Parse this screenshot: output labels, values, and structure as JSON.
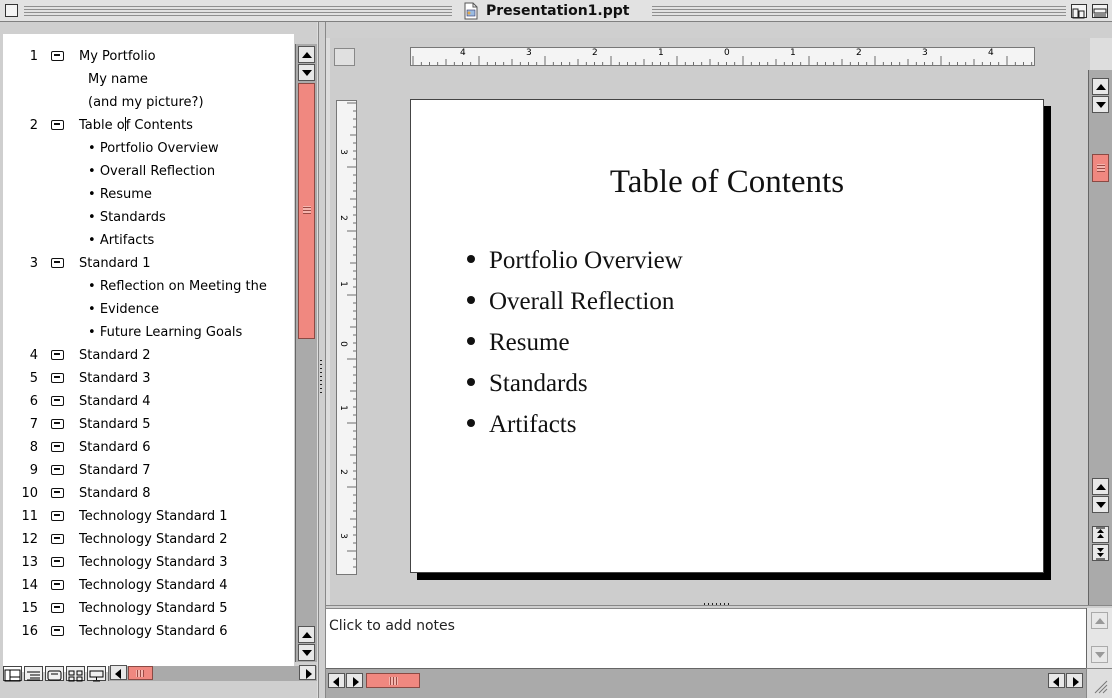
{
  "window": {
    "title": "Presentation1.ppt"
  },
  "outline": {
    "rows": [
      {
        "num": "1",
        "title": "My Portfolio"
      },
      {
        "sub": "My name"
      },
      {
        "sub": "(and my picture?)"
      },
      {
        "num": "2",
        "title_part1": "Table o",
        "title_part2": "f Contents"
      },
      {
        "bullet": "Portfolio Overview"
      },
      {
        "bullet": "Overall Reflection"
      },
      {
        "bullet": "Resume"
      },
      {
        "bullet": "Standards"
      },
      {
        "bullet": "Artifacts"
      },
      {
        "num": "3",
        "title": "Standard 1"
      },
      {
        "bullet": "Reflection on Meeting the"
      },
      {
        "bullet": "Evidence"
      },
      {
        "bullet": "Future Learning Goals"
      },
      {
        "num": "4",
        "title": "Standard 2"
      },
      {
        "num": "5",
        "title": "Standard 3"
      },
      {
        "num": "6",
        "title": "Standard 4"
      },
      {
        "num": "7",
        "title": "Standard 5"
      },
      {
        "num": "8",
        "title": "Standard 6"
      },
      {
        "num": "9",
        "title": "Standard 7"
      },
      {
        "num": "10",
        "title": "Standard 8"
      },
      {
        "num": "11",
        "title": "Technology Standard 1"
      },
      {
        "num": "12",
        "title": "Technology Standard 2"
      },
      {
        "num": "13",
        "title": "Technology Standard 3"
      },
      {
        "num": "14",
        "title": "Technology Standard 4"
      },
      {
        "num": "15",
        "title": "Technology Standard 5"
      },
      {
        "num": "16",
        "title": "Technology Standard 6"
      }
    ]
  },
  "ruler": {
    "horizontal": [
      "4",
      "3",
      "2",
      "1",
      "0",
      "1",
      "2",
      "3",
      "4"
    ],
    "vertical": [
      "3",
      "2",
      "1",
      "0",
      "1",
      "2",
      "3"
    ]
  },
  "slide": {
    "title": "Table of Contents",
    "bullets": [
      "Portfolio Overview",
      "Overall Reflection",
      "Resume",
      "Standards",
      "Artifacts"
    ]
  },
  "notes": {
    "placeholder": "Click to add notes"
  },
  "colors": {
    "scroll_thumb": "#f08880",
    "scroll_track": "#aaaaaa"
  },
  "icons": {
    "title_icon": "ppt-document-icon",
    "slide_icon": "slide-icon",
    "views": [
      "normal-view-icon",
      "outline-view-icon",
      "slide-view-icon",
      "slide-sorter-view-icon",
      "slide-show-view-icon"
    ]
  }
}
